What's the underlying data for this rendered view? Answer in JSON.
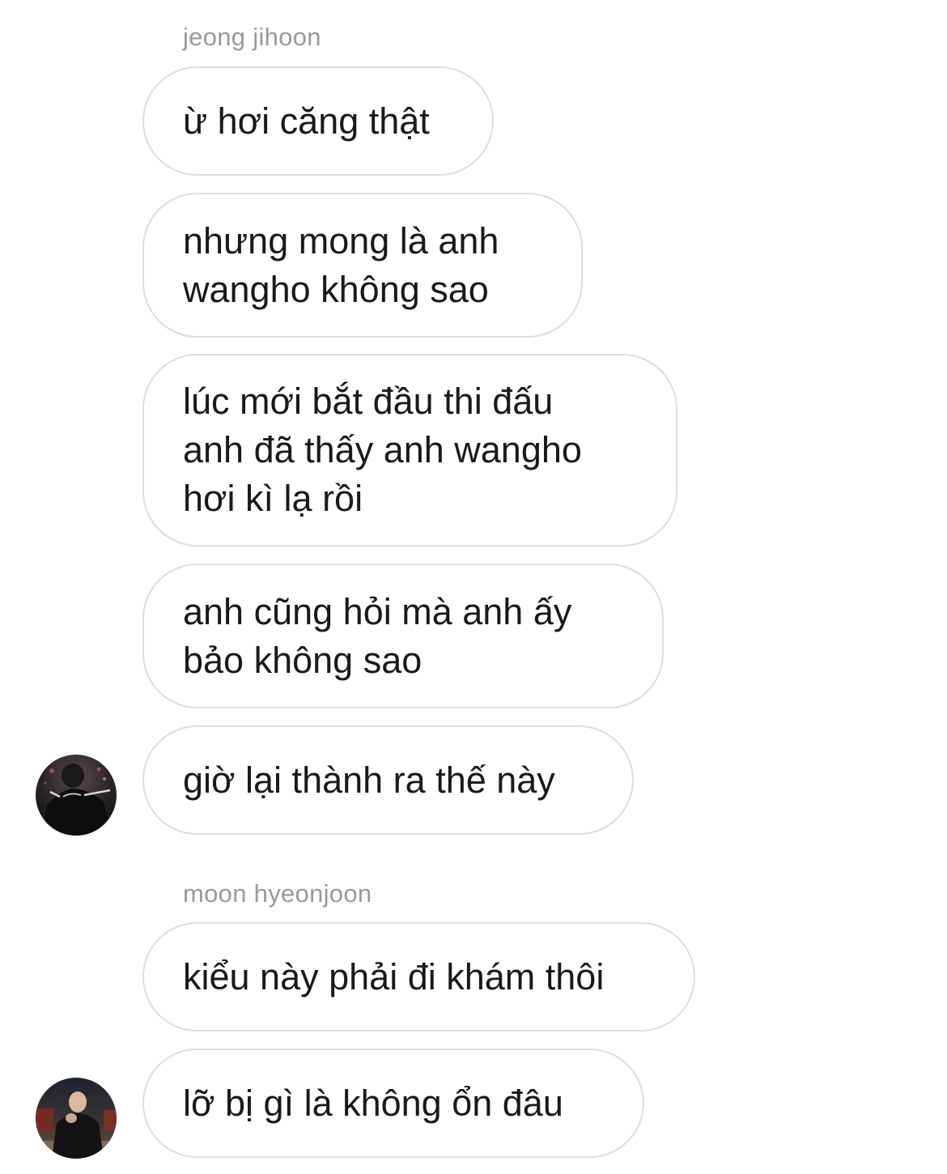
{
  "groups": [
    {
      "sender": "jeong jihoon",
      "avatar_icon": "person-avatar-icon",
      "messages": [
        "ừ hơi căng thật",
        "nhưng mong là anh\nwangho không sao",
        "lúc mới bắt đầu thi đấu\nanh đã thấy anh wangho\nhơi kì lạ rồi",
        "anh cũng hỏi mà anh ấy\nbảo không sao",
        "giờ lại thành ra thế này"
      ]
    },
    {
      "sender": "moon hyeonjoon",
      "avatar_icon": "person-avatar-icon",
      "messages": [
        "kiểu này phải đi khám thôi",
        "lỡ bị gì là không ổn đâu"
      ]
    }
  ],
  "colors": {
    "bubble_border": "#dedede",
    "sender_name": "#9a9a9a",
    "message_text": "#1a1a1a"
  }
}
